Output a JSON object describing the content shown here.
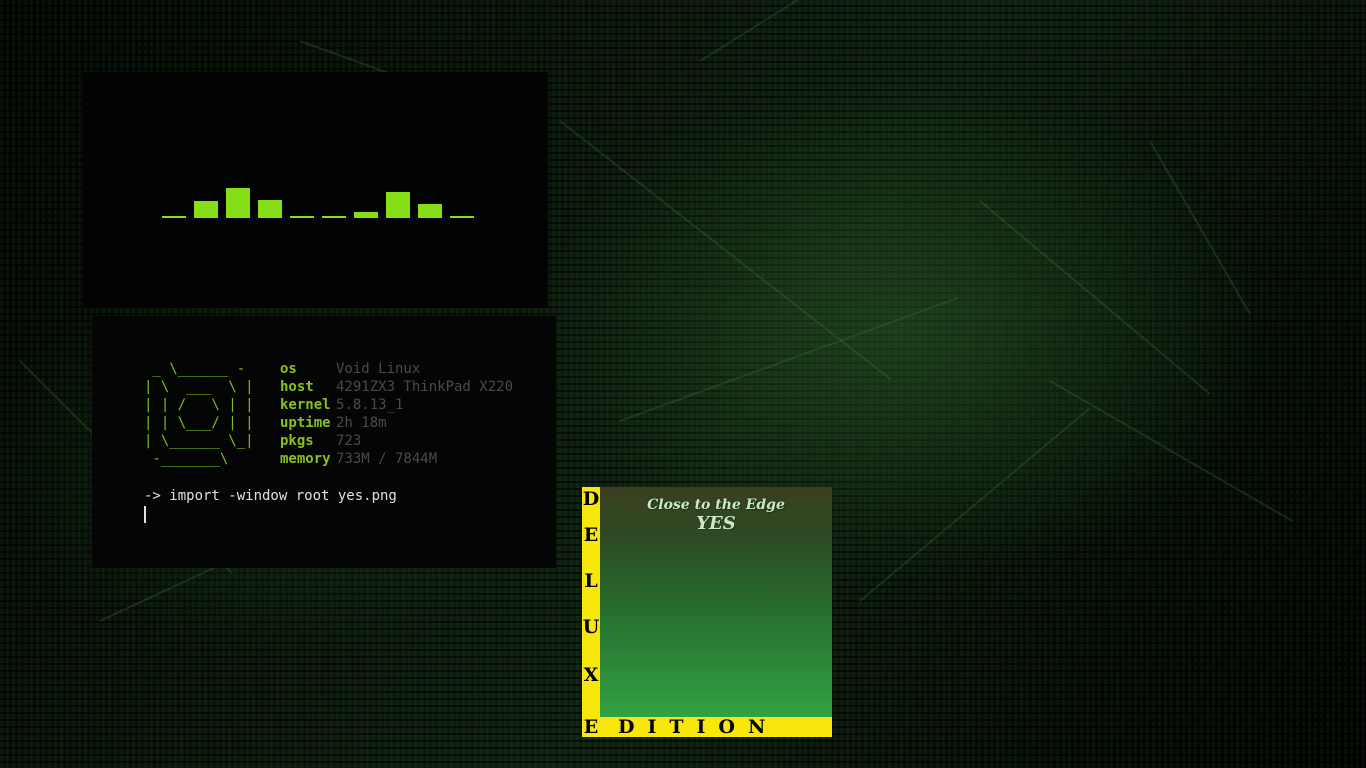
{
  "visualizer": {
    "bar_color": "#87de16",
    "levels": [
      0,
      0.55,
      1.0,
      0.6,
      0,
      0,
      0.2,
      0.85,
      0.45,
      0
    ]
  },
  "terminal": {
    "logo": " _ \\______ -\n| \\  ___  \\ |\n| | /   \\ | |\n| | \\___/ | |\n| \\______ \\_|\n -_______\\",
    "fetch": [
      {
        "key": "os",
        "value": "Void Linux"
      },
      {
        "key": "host",
        "value": "4291ZX3 ThinkPad X220"
      },
      {
        "key": "kernel",
        "value": "5.8.13_1"
      },
      {
        "key": "uptime",
        "value": "2h 18m"
      },
      {
        "key": "pkgs",
        "value": "723"
      },
      {
        "key": "memory",
        "value": "733M / 7844M"
      }
    ],
    "prompt": "-> import -window root yes.png",
    "key_color": "#87c11c",
    "logo_color": "#79c21a"
  },
  "album": {
    "title": "Close to the Edge",
    "artist_logo": "YES",
    "side_text": [
      "D",
      "E",
      "L",
      "U",
      "X"
    ],
    "corner_letter": "E",
    "bottom_text": "DITION",
    "banner_color": "#f7e70a"
  }
}
